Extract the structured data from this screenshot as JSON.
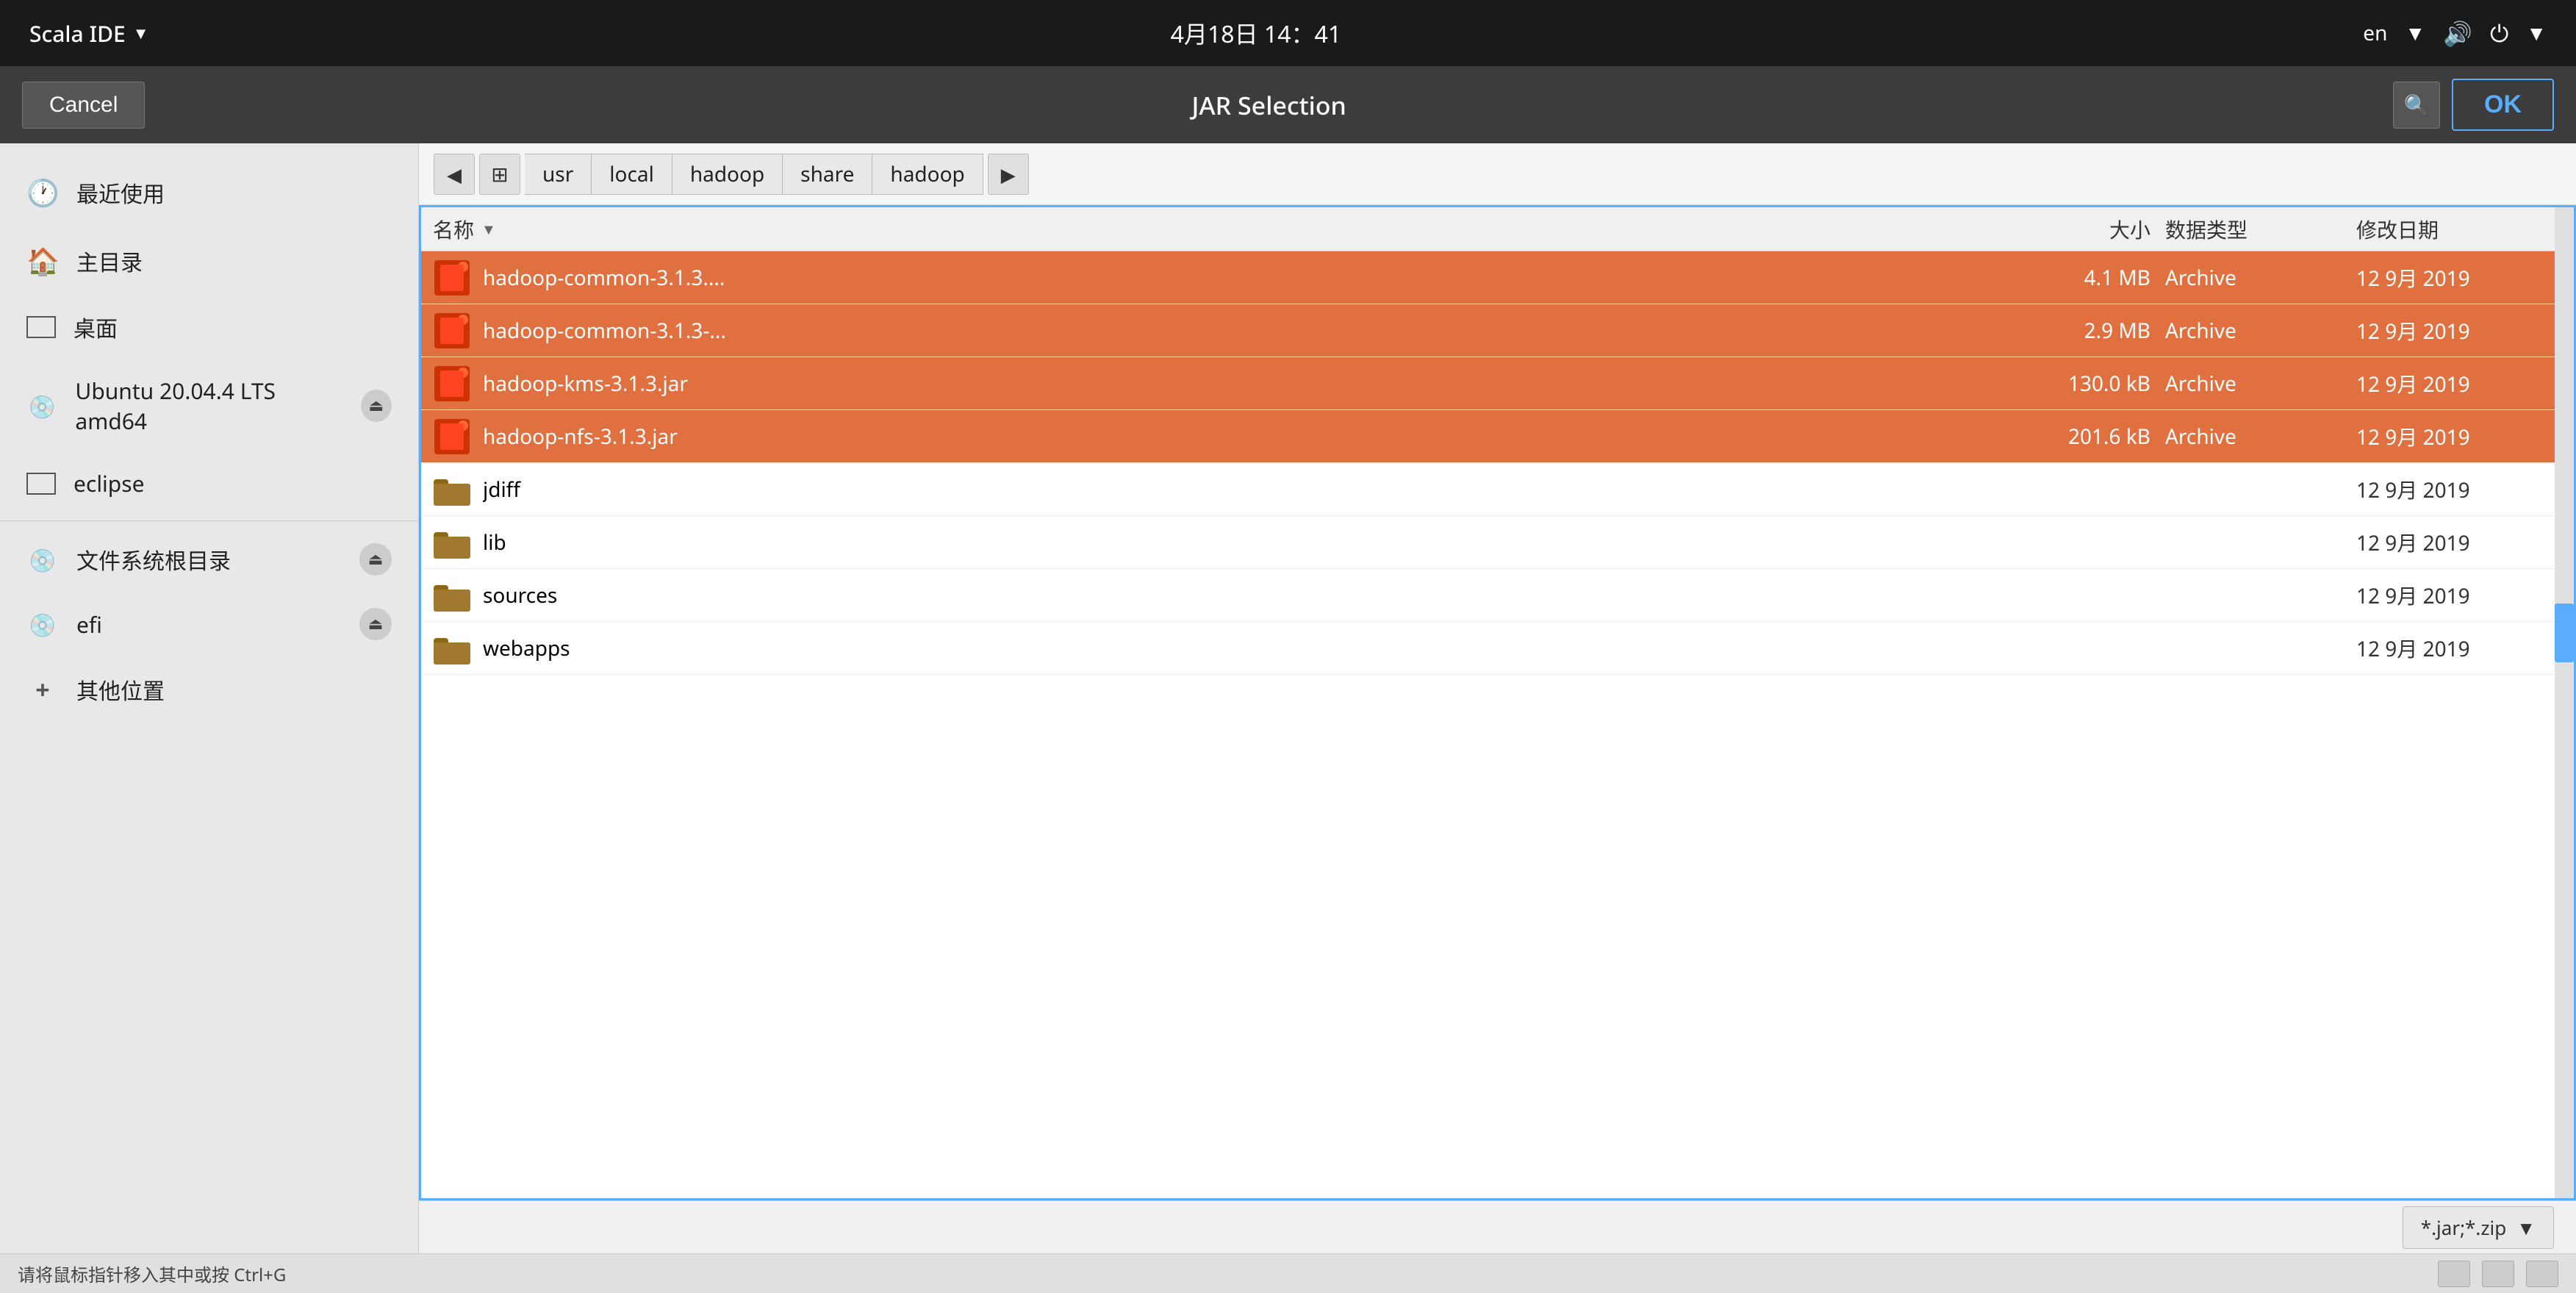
{
  "system_bar": {
    "app_name": "Scala IDE",
    "dropdown_arrow": "▼",
    "datetime": "4月18日  14：41",
    "lang": "en",
    "lang_arrow": "▼",
    "volume_icon": "🔊",
    "power_icon": "⏻",
    "power_arrow": "▼"
  },
  "dialog": {
    "cancel_label": "Cancel",
    "title": "JAR Selection",
    "ok_label": "OK"
  },
  "sidebar": {
    "items": [
      {
        "id": "recent",
        "icon": "🕐",
        "label": "最近使用",
        "eject": false
      },
      {
        "id": "home",
        "icon": "🏠",
        "label": "主目录",
        "eject": false
      },
      {
        "id": "desktop",
        "icon": "▭",
        "label": "桌面",
        "eject": false
      },
      {
        "id": "ubuntu",
        "icon": "◎",
        "label": "Ubuntu 20.04.4 LTS amd64",
        "eject": true
      },
      {
        "id": "eclipse",
        "icon": "▭",
        "label": "eclipse",
        "eject": false
      },
      {
        "id": "fsroot",
        "icon": "◎",
        "label": "文件系统根目录",
        "eject": true
      },
      {
        "id": "efi",
        "icon": "◎",
        "label": "efi",
        "eject": true
      },
      {
        "id": "other",
        "icon": "+",
        "label": "其他位置",
        "eject": false
      }
    ]
  },
  "breadcrumb": {
    "back_label": "◀",
    "home_icon": "⊞",
    "segments": [
      "usr",
      "local",
      "hadoop",
      "share",
      "hadoop"
    ],
    "more_label": "▶"
  },
  "file_list": {
    "columns": {
      "name_label": "名称",
      "size_label": "大小",
      "type_label": "数据类型",
      "date_label": "修改日期"
    },
    "files": [
      {
        "type": "jar",
        "name": "hadoop-common-3.1.3....",
        "size": "4.1 MB",
        "file_type": "Archive",
        "date": "12 9月 2019",
        "selected": true
      },
      {
        "type": "jar",
        "name": "hadoop-common-3.1.3-...",
        "size": "2.9 MB",
        "file_type": "Archive",
        "date": "12 9月 2019",
        "selected": true
      },
      {
        "type": "jar",
        "name": "hadoop-kms-3.1.3.jar",
        "size": "130.0 kB",
        "file_type": "Archive",
        "date": "12 9月 2019",
        "selected": true
      },
      {
        "type": "jar",
        "name": "hadoop-nfs-3.1.3.jar",
        "size": "201.6 kB",
        "file_type": "Archive",
        "date": "12 9月 2019",
        "selected": true
      },
      {
        "type": "folder",
        "name": "jdiff",
        "size": "",
        "file_type": "",
        "date": "12 9月 2019",
        "selected": false
      },
      {
        "type": "folder",
        "name": "lib",
        "size": "",
        "file_type": "",
        "date": "12 9月 2019",
        "selected": false
      },
      {
        "type": "folder",
        "name": "sources",
        "size": "",
        "file_type": "",
        "date": "12 9月 2019",
        "selected": false
      },
      {
        "type": "folder",
        "name": "webapps",
        "size": "",
        "file_type": "",
        "date": "12 9月 2019",
        "selected": false
      }
    ]
  },
  "filter": {
    "label": "*.jar;*.zip",
    "arrow": "▼"
  },
  "status_bar": {
    "hint": "请将鼠标指针移入其中或按 Ctrl+G"
  }
}
